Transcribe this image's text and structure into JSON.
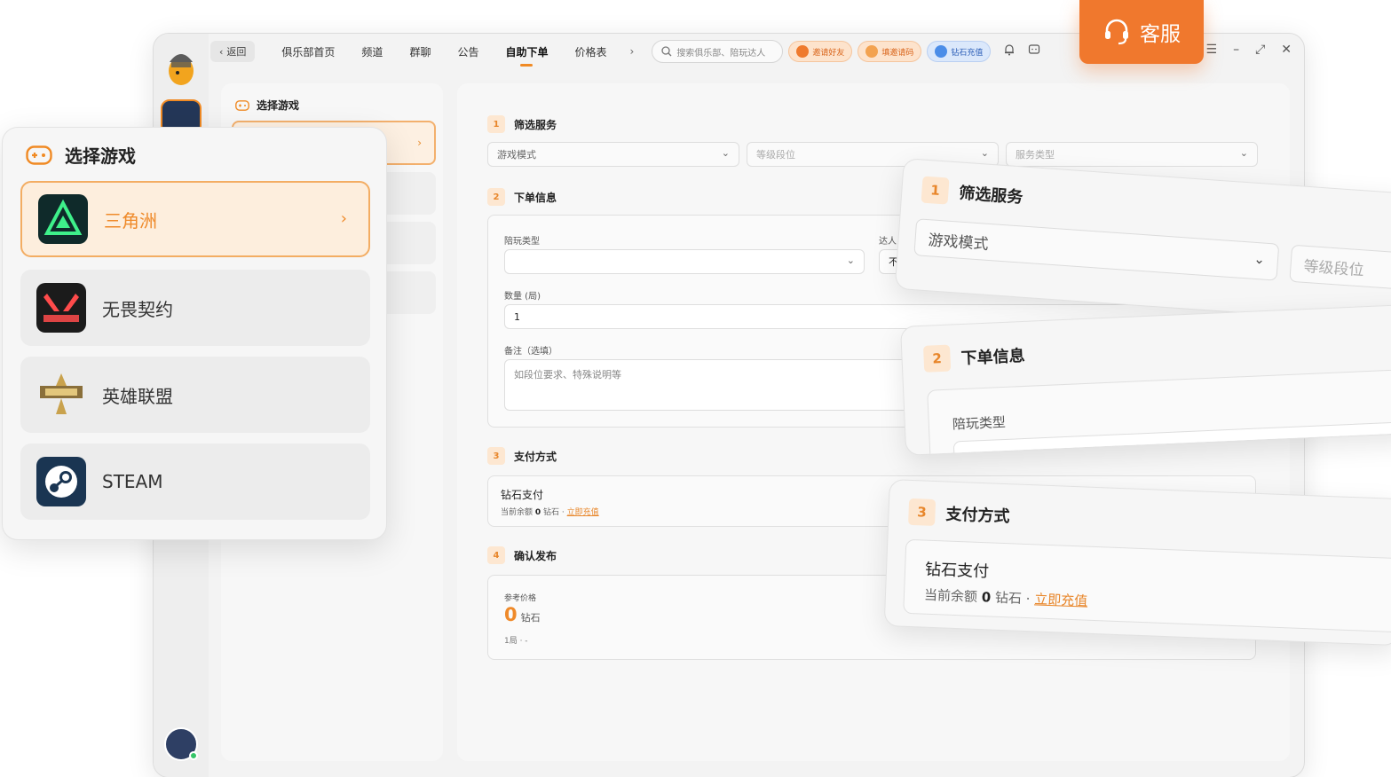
{
  "topbar": {
    "back": "返回",
    "nav": [
      "俱乐部首页",
      "频道",
      "群聊",
      "公告",
      "自助下单",
      "价格表"
    ],
    "more": "›",
    "search_placeholder": "搜索俱乐部、陪玩达人",
    "pills": [
      "邀请好友",
      "填邀请码",
      "钻石充值"
    ]
  },
  "kefu": {
    "label": "客服"
  },
  "sidebar": {
    "title": "选择游戏"
  },
  "form": {
    "step1": {
      "num": "1",
      "title": "筛选服务",
      "dropdowns": [
        "游戏模式",
        "等级段位",
        "服务类型"
      ]
    },
    "step2": {
      "num": "2",
      "title": "下单信息",
      "companion_label": "陪玩类型",
      "expert_label": "达人",
      "expert_value": "不",
      "quantity_label": "数量 (局)",
      "quantity_value": "1",
      "note_label": "备注（选填）",
      "note_placeholder": "如段位要求、特殊说明等"
    },
    "step3": {
      "num": "3",
      "title": "支付方式",
      "method": "钻石支付",
      "balance_prefix": "当前余额",
      "balance_value": "0",
      "balance_unit": "钻石 ·",
      "recharge": "立即充值"
    },
    "step4": {
      "num": "4",
      "title": "确认发布",
      "price_label": "参考价格",
      "price_value": "0",
      "price_unit": "钻石",
      "price_note": "1局 · -"
    }
  },
  "game_card": {
    "title": "选择游戏",
    "games": [
      {
        "name": "三角洲",
        "active": true
      },
      {
        "name": "无畏契约",
        "active": false
      },
      {
        "name": "英雄联盟",
        "active": false
      },
      {
        "name": "STEAM",
        "active": false
      }
    ]
  },
  "float1": {
    "num": "1",
    "title": "筛选服务",
    "dropdown1": "游戏模式",
    "dropdown2": "等级段位"
  },
  "float2": {
    "num": "2",
    "title": "下单信息",
    "label": "陪玩类型"
  },
  "float3": {
    "num": "3",
    "title": "支付方式",
    "method": "钻石支付",
    "balance_prefix": "当前余额",
    "balance_value": "0",
    "balance_unit": "钻石 ·",
    "recharge": "立即充值"
  },
  "colors": {
    "accent": "#f0782d",
    "accent_light": "#fdeedd",
    "blue_pill": "#dbe8fb"
  },
  "icons": [
    "logo-icon",
    "search-icon",
    "bell-icon",
    "chat-icon",
    "menu-icon",
    "minimize-icon",
    "maximize-icon",
    "close-icon",
    "headset-icon",
    "gamepad-icon",
    "chevron-right-icon",
    "chevron-down-icon"
  ]
}
